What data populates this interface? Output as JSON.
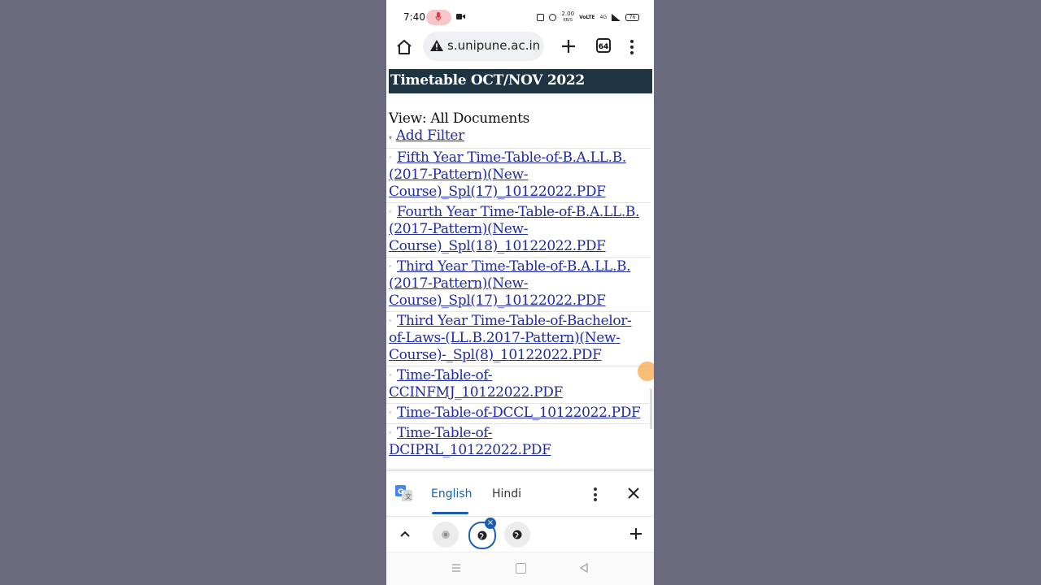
{
  "status_bar": {
    "time": "7:40",
    "icons": [
      "mic-icon",
      "video-camera-icon",
      "nfc-icon",
      "alarm-icon",
      "data-speed-icon",
      "volte-icon",
      "4g-signal-icon",
      "signal-icon",
      "battery-icon"
    ],
    "data_speed": "2.00",
    "data_speed_unit": "KB/S",
    "network": "4G",
    "battery": "76"
  },
  "browser": {
    "url": "s.unipune.ac.in",
    "tab_count": "64",
    "icons": [
      "home-icon",
      "warning-icon",
      "plus-icon",
      "overflow-menu-icon"
    ]
  },
  "page": {
    "title": "Timetable OCT/NOV 2022",
    "view_label": "View: All Documents",
    "add_filter": "Add Filter",
    "documents": [
      "Fifth Year Time-Table-of-B.A.LL.B.(2017-Pattern)(New-Course)_Spl(17)_10122022.PDF",
      "Fourth Year Time-Table-of-B.A.LL.B.(2017-Pattern)(New-Course)_Spl(18)_10122022.PDF",
      "Third Year Time-Table-of-B.A.LL.B.(2017-Pattern)(New-Course)_Spl(17)_10122022.PDF",
      "Third Year Time-Table-of-Bachelor-of-Laws-(LL.B.2017-Pattern)(New-Course)-_Spl(8)_10122022.PDF",
      "Time-Table-of-CCINFMJ_10122022.PDF",
      "Time-Table-of-DCCL_10122022.PDF",
      "Time-Table-of-DCIPRL_10122022.PDF"
    ]
  },
  "translate_bar": {
    "lang_selected": "English",
    "lang_other": "Hindi"
  },
  "tab_strip": {
    "close_badge": "×"
  },
  "colors": {
    "title_bar_bg": "#1e3442",
    "link": "#1f2aa3",
    "accent": "#1a5fb4"
  }
}
